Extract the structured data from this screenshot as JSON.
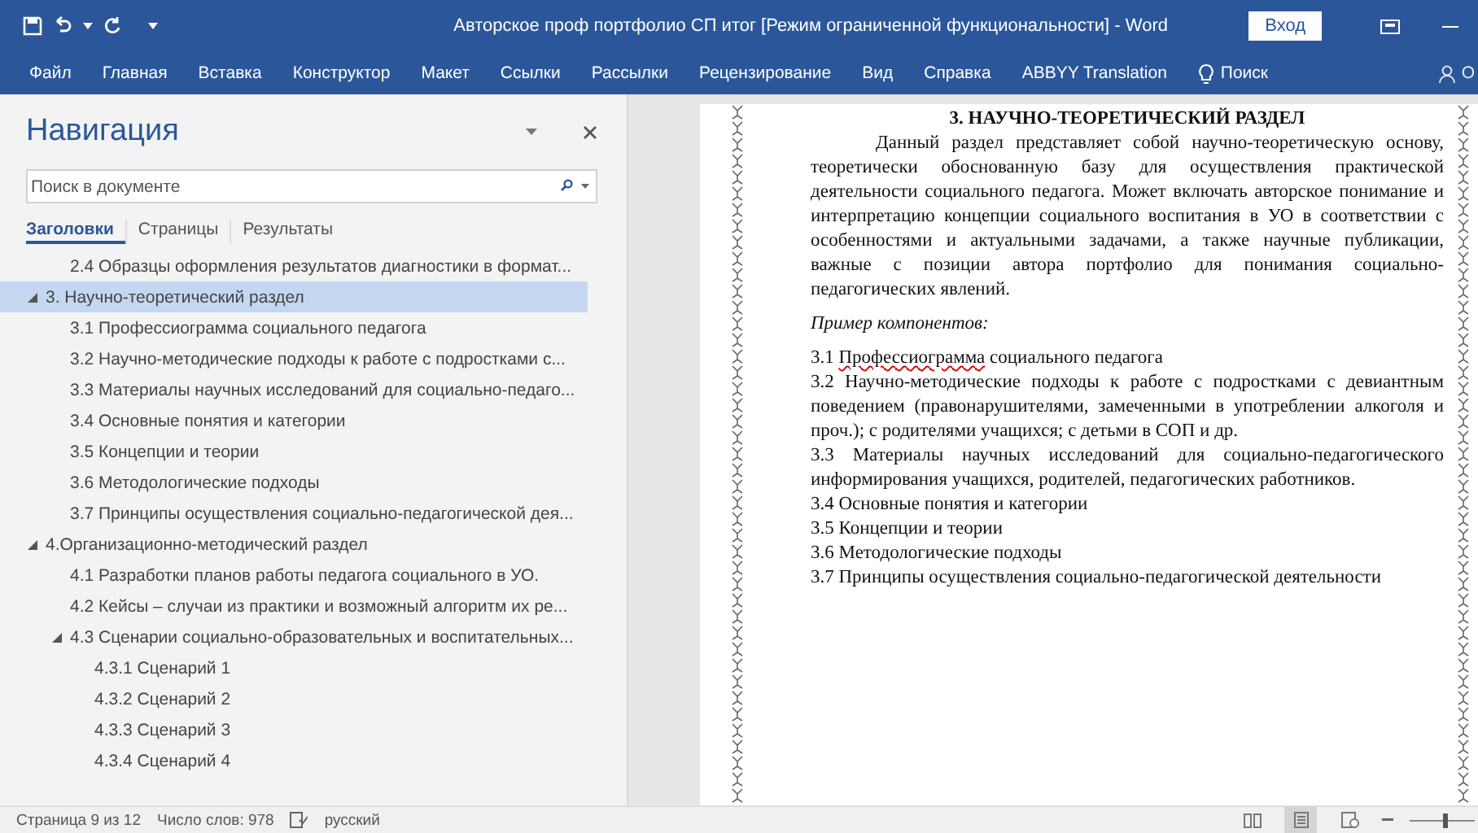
{
  "window": {
    "title": "Авторское проф портфолио СП итог [Режим ограниченной функциональности]  -  Word",
    "sign_in": "Вход"
  },
  "ribbon_tabs": [
    {
      "label": "Файл",
      "selected": false
    },
    {
      "label": "Главная",
      "selected": false
    },
    {
      "label": "Вставка",
      "selected": false
    },
    {
      "label": "Конструктор",
      "selected": false
    },
    {
      "label": "Макет",
      "selected": false
    },
    {
      "label": "Ссылки",
      "selected": false
    },
    {
      "label": "Рассылки",
      "selected": false
    },
    {
      "label": "Рецензирование",
      "selected": false
    },
    {
      "label": "Вид",
      "selected": false
    },
    {
      "label": "Справка",
      "selected": false
    },
    {
      "label": "ABBYY Translation",
      "selected": false
    }
  ],
  "tell_me": "Поиск",
  "share": "О",
  "navigation": {
    "title": "Навигация",
    "search": {
      "placeholder": "Поиск в документе"
    },
    "tabs": [
      {
        "label": "Заголовки",
        "selected": true
      },
      {
        "label": "Страницы",
        "selected": false
      },
      {
        "label": "Результаты",
        "selected": false
      }
    ],
    "continued": [
      {
        "text": "2.4 Образцы оформления результатов диагностики в формат...",
        "selected": false
      }
    ],
    "headings": [
      {
        "text": "3. Научно-теоретический раздел",
        "selected": true,
        "expanded": true,
        "children": [
          {
            "text": "3.1 Профессиограмма социального педагога",
            "selected": false
          },
          {
            "text": "3.2 Научно-методические подходы к работе с подростками с...",
            "selected": false
          },
          {
            "text": "3.3 Материалы научных исследований для социально-педаго...",
            "selected": false
          },
          {
            "text": "3.4 Основные понятия и категории",
            "selected": false
          },
          {
            "text": "3.5 Концепции и теории",
            "selected": false
          },
          {
            "text": "3.6 Методологические подходы",
            "selected": false
          },
          {
            "text": "3.7 Принципы осуществления социально-педагогической дея...",
            "selected": false
          }
        ]
      },
      {
        "text": "4.Организационно-методический раздел",
        "selected": false,
        "expanded": true,
        "children": [
          {
            "text": "4.1 Разработки планов работы педагога социального в УО.",
            "selected": false
          },
          {
            "text": "4.2 Кейсы – случаи из практики и возможный алгоритм их ре...",
            "selected": false
          },
          {
            "text": "4.3 Сценарии социально-образовательных и воспитательных...",
            "selected": false,
            "expanded": true,
            "children": [
              {
                "text": "4.3.1 Сценарий 1",
                "selected": false
              },
              {
                "text": "4.3.2 Сценарий 2",
                "selected": false
              },
              {
                "text": "4.3.3 Сценарий 3",
                "selected": false
              },
              {
                "text": "4.3.4 Сценарий 4",
                "selected": false
              }
            ]
          }
        ]
      }
    ]
  },
  "document": {
    "heading": "3. НАУЧНО-ТЕОРЕТИЧЕСКИЙ РАЗДЕЛ",
    "paragraph": "Данный раздел представляет собой научно-теоретическую основу, теоретически обоснованную базу для осуществления практической деятельности социального педагога. Может включать авторское понимание и интерпретацию концепции социального воспитания в УО в соответствии с особенностями и актуальными задачами, а также научные публикации, важные с позиции автора портфолио для понимания социально-педагогических явлений.",
    "example_label": "Пример компонентов:",
    "items": [
      {
        "parts": [
          {
            "text": "3.1 ",
            "misspelled": false
          },
          {
            "text": "Профессиограмма",
            "misspelled": true
          },
          {
            "text": " социального педагога",
            "misspelled": false
          }
        ]
      },
      {
        "parts": [
          {
            "text": "3.2 Научно-методические подходы к работе с подростками с девиантным поведением (правонарушителями, замеченными в употреблении алкоголя и проч.); с родителями учащихся; с детьми в СОП и др.",
            "misspelled": false
          }
        ]
      },
      {
        "parts": [
          {
            "text": "3.3 Материалы научных исследований для социально-педагогического информирования учащихся, родителей, педагогических работников.",
            "misspelled": false
          }
        ]
      },
      {
        "parts": [
          {
            "text": "3.4 Основные понятия и категории",
            "misspelled": false
          }
        ]
      },
      {
        "parts": [
          {
            "text": "3.5 Концепции и теории",
            "misspelled": false
          }
        ]
      },
      {
        "parts": [
          {
            "text": "3.6 Методологические подходы",
            "misspelled": false
          }
        ]
      },
      {
        "parts": [
          {
            "text": "3.7 Принципы осуществления социально-педагогической деятельности",
            "misspelled": false
          }
        ]
      }
    ]
  },
  "status_bar": {
    "page": "Страница 9 из 12",
    "words": "Число слов: 978",
    "language": "русский",
    "views": [
      {
        "kind": "read",
        "selected": false
      },
      {
        "kind": "print",
        "selected": true
      },
      {
        "kind": "web",
        "selected": false
      }
    ],
    "zoom": {
      "level": 0.55
    }
  }
}
